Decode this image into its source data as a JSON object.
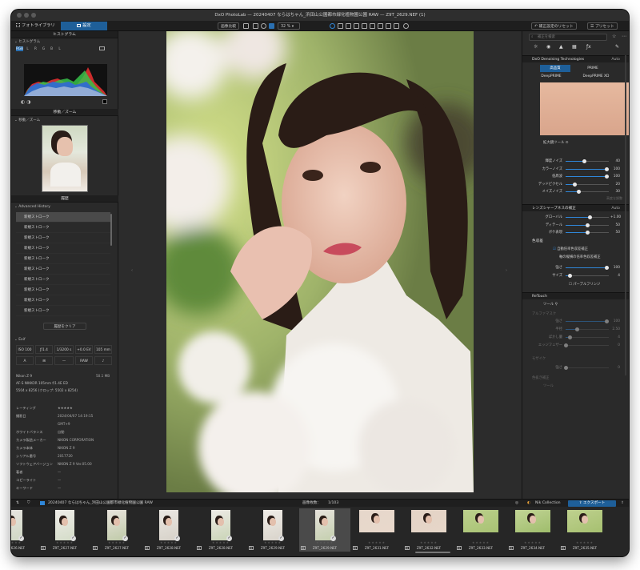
{
  "window": {
    "title": "DxO PhotoLab — 20240407 ならはちゃん_浜田山公園都市緑化植物園公園 RAW — Z9T_2629.NEF (1)"
  },
  "tabs": [
    {
      "label": "フォトライブラリ"
    },
    {
      "label": "設定"
    }
  ],
  "toolbar": {
    "compare": "画像比較",
    "zoom": "32 %",
    "reset": "補正設定のリセット",
    "preset": "プリセット"
  },
  "left": {
    "histogram": {
      "title": "ヒストグラム",
      "sub": "ヒストグラム",
      "channels": [
        "RGB",
        "L",
        "R",
        "G",
        "B",
        "L"
      ]
    },
    "navigator": {
      "title": "移動／ズーム",
      "sub": "移動／ズーム"
    },
    "history": {
      "title": "履歴",
      "sub": "Advanced History",
      "items": [
        "新規ストローク",
        "新規ストローク",
        "新規ストローク",
        "新規ストローク",
        "新規ストローク",
        "新規ストローク",
        "新規ストローク",
        "新規ストローク",
        "新規ストローク",
        "新規ストローク"
      ],
      "clear": "履歴をクリア"
    },
    "exif": {
      "title": "Exif",
      "cells": [
        "ISO 100",
        "ƒ/1.4",
        "1/3200 s",
        "+0.0 EV",
        "105 mm",
        "A",
        "",
        "—",
        "RAW",
        ""
      ],
      "camera": "Nikon Z 9",
      "size": "50.1 MB",
      "lens": "AF-S NIKKOR 105mm f/1.4E ED",
      "dims": "5504 x 8256 (クロップ: 5502 x 8254)",
      "rows": [
        {
          "k": "レーティング",
          "v": "★★★★★"
        },
        {
          "k": "撮影日",
          "v": "2024/04/07 14:19:15"
        },
        {
          "k": "",
          "v": "GMT+9"
        },
        {
          "k": "ホワイトバランス",
          "v": "自動"
        },
        {
          "k": "カメラ製造メーカー",
          "v": "NIKON CORPORATION"
        },
        {
          "k": "カメラ本体",
          "v": "NIKON Z 9"
        },
        {
          "k": "シリアル番号",
          "v": "2017720"
        },
        {
          "k": "ソフトウェアバージョン",
          "v": "NIKON Z 9 Ver.05.00"
        },
        {
          "k": "著者",
          "v": "—"
        },
        {
          "k": "コピーライト",
          "v": "—"
        },
        {
          "k": "キーワード",
          "v": "—"
        }
      ]
    }
  },
  "right": {
    "search_placeholder": "補正を検索",
    "denoise": {
      "title": "DxO Denoising Technologies",
      "auto": "Auto",
      "mode_hq": "高品質",
      "mode_prime": "PRIME",
      "mode_deep": "DeepPRIME",
      "mode_deepxd": "DeepPRIME XD",
      "zoom_tool": "拡大鏡ツール",
      "sliders": [
        {
          "label": "輝度ノイズ",
          "value": "40",
          "pct": 0.42
        },
        {
          "label": "カラーノイズ",
          "value": "100",
          "pct": 0.95
        },
        {
          "label": "低周波",
          "value": "100",
          "pct": 0.95
        },
        {
          "label": "デッドピクセル",
          "value": "20",
          "pct": 0.2
        },
        {
          "label": "メイズノイズ",
          "value": "30",
          "pct": 0.3
        }
      ],
      "preview_area": "高度な調整"
    },
    "lens": {
      "title": "レンズシャープネスの補正",
      "auto": "Auto",
      "sliders": [
        {
          "label": "グローバル",
          "value": "+1.00",
          "pct": 0.55
        },
        {
          "label": "ディテール",
          "value": "50",
          "pct": 0.5
        },
        {
          "label": "ボケ表現",
          "value": "50",
          "pct": 0.5
        }
      ]
    },
    "fringe": {
      "title": "色収差",
      "auto_label": "自動倍率色収差補正",
      "strong": "軸の縦横の倍率色収差補正",
      "sliders": [
        {
          "label": "強さ",
          "value": "100",
          "pct": 0.95
        },
        {
          "label": "サイズ",
          "value": "4",
          "pct": 0.1
        }
      ],
      "purple": "パープルフリンジ"
    },
    "retouch": {
      "title": "ReTouch",
      "tool": "ツール",
      "sub1": "アルファマスク",
      "sliders": [
        {
          "label": "強さ",
          "value": "100",
          "pct": 0.95
        },
        {
          "label": "半径",
          "value": "2.50",
          "pct": 0.25
        },
        {
          "label": "ぼかし量",
          "value": "4",
          "pct": 0.1
        },
        {
          "label": "エッジフェザー",
          "value": "0",
          "pct": 0.0
        }
      ],
      "sub2": "モザイク",
      "sliders2": [
        {
          "label": "強さ",
          "value": "0",
          "pct": 0.0
        }
      ],
      "sub3": "色抜き補正",
      "tool2": "ツール"
    }
  },
  "filmbar": {
    "path": "20240407 ならはちゃん_浜田山公園都市緑化植物園公園 RAW",
    "count_label": "画像枚数：",
    "count": "1/103",
    "nik": "Nik Collection",
    "export": "エクスポート"
  },
  "film": [
    {
      "name": "Z9T_2626.NEF"
    },
    {
      "name": "Z9T_2627.NEF"
    },
    {
      "name": "Z9T_2627.NEF"
    },
    {
      "name": "Z9T_2628.NEF"
    },
    {
      "name": "Z9T_2628.NEF"
    },
    {
      "name": "Z9T_2629.NEF"
    },
    {
      "name": "Z9T_2629.NEF"
    },
    {
      "name": "Z9T_2631.NEF"
    },
    {
      "name": "Z9T_2632.NEF"
    },
    {
      "name": "Z9T_2633.NEF"
    },
    {
      "name": "Z9T_2634.NEF"
    },
    {
      "name": "Z9T_2635.NEF"
    }
  ],
  "colors": {
    "accent": "#2f86d8",
    "panel": "#2a2a2a",
    "header": "#1f1f1f"
  }
}
